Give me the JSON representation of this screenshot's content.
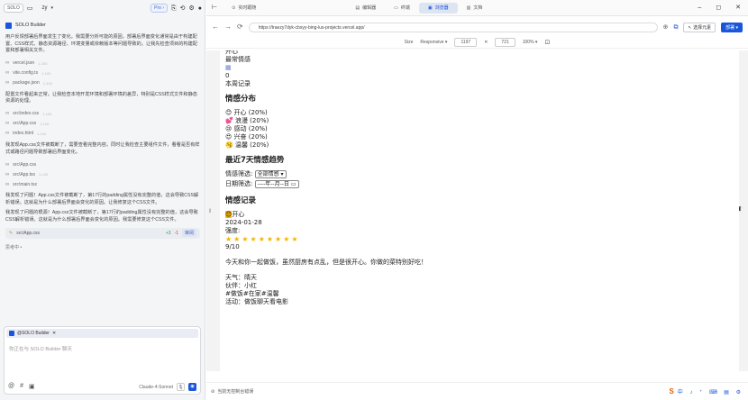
{
  "left": {
    "logo": "SOLO",
    "workspace": "zy",
    "pro_label": "Pro",
    "agent_name": "SOLO Builder",
    "intro_msg": "用户反馈部署后界面发生了变化。我需要分析可能的原因，部署后界面变化通常是由于构建配置、CSS样式、静态资源路径、环境变量或依赖版本等问题导致的。让我先检查项目的构建配置和部署相关文件。",
    "files_a": [
      "vercel.json",
      "vite.config.ts",
      "package.json"
    ],
    "msg2": "配置文件看起来正常。让我检查本地开发环境和部署环境的差异，特别是CSS样式文件和静态资源的处理。",
    "files_b": [
      "src\\index.css",
      "src\\App.css",
      "index.html"
    ],
    "msg3": "我发现App.css文件被截断了，需要查看完整内容。同时让我检查主要组件文件，看看是否有样式或路径问题导致部署后界面变化。",
    "files_c": [
      "src\\App.css",
      "src\\App.tsx",
      "src\\main.tsx"
    ],
    "tag_label": "1-100",
    "msg4": "我发现了问题！App.css文件被截断了，第17行的padding属性没有完整的值，这会导致CSS解析错误。这就是为什么部署后界面会变化的原因。让我修复这个CSS文件。",
    "msg5": "我发现了问题的根源！App.css文件被截断了，第17行的padding属性没有完整的值，这会导致CSS解析错误。这就是为什么部署后界面会变化的原因。我需要修复这个CSS文件。",
    "edited_file": "src\\App.css",
    "diff_add": "+3",
    "diff_del": "-1",
    "review_btn": "审阅",
    "thinking": "思考中",
    "mention": "@SOLO Builder",
    "placeholder": "你正在与 SOLO Builder 聊天",
    "model": "Claude-4-Sonnet"
  },
  "browser": {
    "tabs": [
      "实时跟随",
      "编辑器",
      "终端",
      "浏览器",
      "文档"
    ],
    "active_tab": 3,
    "url": "https://traezy7dyk-cbsyy-bing-lus-projects.vercel.app/",
    "picker_btn": "选择元素",
    "deploy_btn": "部署",
    "size_label": "Size",
    "size_mode": "Responsive",
    "width": "1197",
    "height": "721",
    "zoom": "100%",
    "status": "当前无控制台错误"
  },
  "app": {
    "open_prefix": "开心",
    "most_common_label": "最常情感",
    "zero": "0",
    "weekly_label": "本周记录",
    "dist_title": "情感分布",
    "dist": [
      {
        "emoji": "😊",
        "text": "开心 (20%)"
      },
      {
        "emoji": "💕",
        "text": "浪漫 (20%)"
      },
      {
        "emoji": "😢",
        "text": "感动 (20%)"
      },
      {
        "emoji": "😍",
        "text": "兴奋 (20%)"
      },
      {
        "emoji": "🥱",
        "text": "温馨 (20%)"
      }
    ],
    "trend_title": "最近7天情感趋势",
    "filter_label": "情感筛选:",
    "filter_value": "全部情感",
    "date_label": "日期筛选:",
    "date_value": "----年--月--日",
    "records_title": "情感记录",
    "record_emotion": "开心",
    "record_date": "2024-01-28",
    "intensity_label": "强度:",
    "stars": "★★★★★★★★★",
    "score": "9/10",
    "note": "今天和你一起做饭，虽然厨房有点乱，但是很开心。你做的菜特别好吃！",
    "weather": "天气：晴天",
    "partner": "伙伴：小红",
    "tags": "#做饭#在家#温馨",
    "activity": "活动：做饭聊天看电影"
  },
  "colors": {
    "accent": "#1a56db",
    "star": "#f5b400"
  }
}
